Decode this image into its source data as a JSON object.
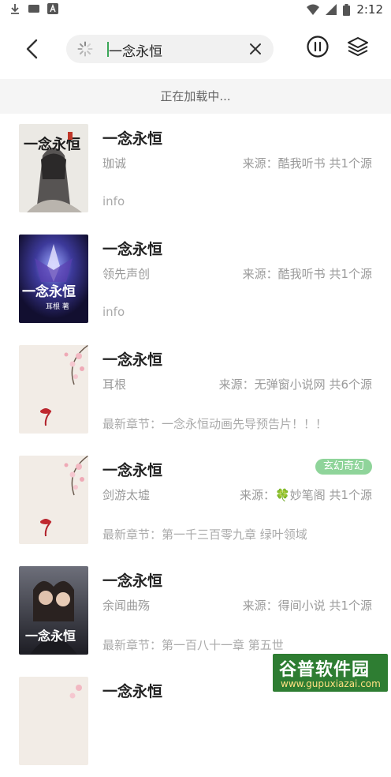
{
  "status_bar": {
    "time": "2:12"
  },
  "search": {
    "query": "一念永恒"
  },
  "loading_text": "正在加载中...",
  "results": [
    {
      "title": "一念永恒",
      "author": "珈诚",
      "source": "来源：酷我听书 共1个源",
      "extra": "info",
      "tag": ""
    },
    {
      "title": "一念永恒",
      "author": "领先声创",
      "source": "来源：酷我听书 共1个源",
      "extra": "info",
      "tag": ""
    },
    {
      "title": "一念永恒",
      "author": "耳根",
      "source": "来源：无弹窗小说网 共6个源",
      "extra": "最新章节：一念永恒动画先导预告片！！！",
      "tag": ""
    },
    {
      "title": "一念永恒",
      "author": "剑游太墟",
      "source_prefix": "来源：",
      "source_icon": "🍀",
      "source_rest": "妙笔阁 共1个源",
      "extra": "最新章节：第一千三百零九章 绿叶领域",
      "tag": "玄幻奇幻"
    },
    {
      "title": "一念永恒",
      "author": "余闻曲殇",
      "source": "来源：得间小说 共1个源",
      "extra": "最新章节：第一百八十一章 第五世",
      "tag": ""
    },
    {
      "title": "一念永恒"
    }
  ],
  "covers": {
    "cover1_text": "一念永恒",
    "cover2_text": "一念永恒",
    "cover2_sub": "耳根 著",
    "cover5_text": "一念永恒"
  },
  "watermark": {
    "main": "谷普软件园",
    "sub": "www.gupuxiazai.com"
  },
  "colors": {
    "accent": "#3aa657",
    "tag_bg": "#8fd49a",
    "loading_bg": "#f5f5f5"
  }
}
